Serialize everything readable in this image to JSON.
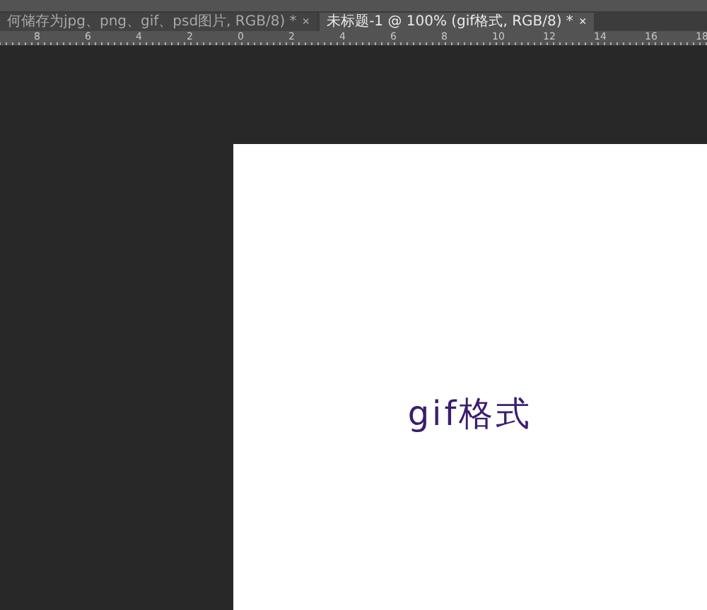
{
  "tabs": [
    {
      "label": "何储存为jpg、png、gif、psd图片, RGB/8) *",
      "close": "×",
      "selected": false
    },
    {
      "label": "未标题-1 @ 100% (gif格式, RGB/8) *",
      "close": "×",
      "selected": true
    }
  ],
  "ruler": {
    "labels": [
      "8",
      "6",
      "4",
      "2",
      "0",
      "2",
      "4",
      "6",
      "8",
      "10",
      "12",
      "14",
      "16",
      "18"
    ]
  },
  "document": {
    "text": "gif格式"
  }
}
